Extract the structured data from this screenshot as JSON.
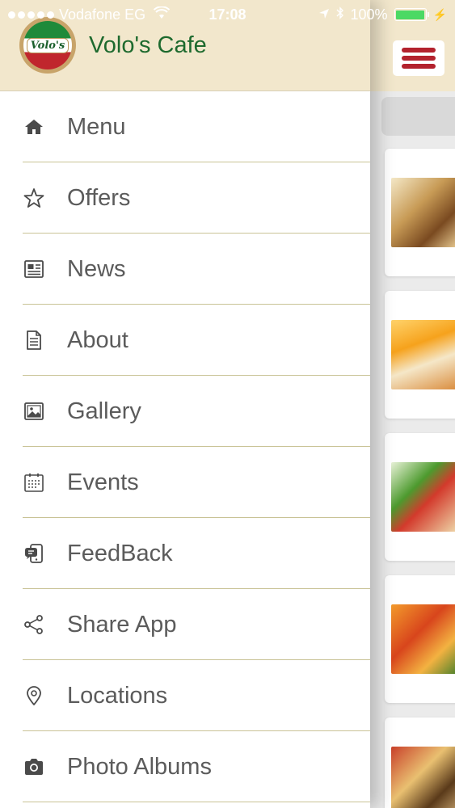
{
  "status_bar": {
    "carrier": "Vodafone EG",
    "time": "17:08",
    "battery": "100%",
    "battery_level": 1.0
  },
  "drawer": {
    "app_title": "Volo's Cafe",
    "logo_text": "Volo's",
    "items": [
      {
        "label": "Menu",
        "icon": "home-icon"
      },
      {
        "label": "Offers",
        "icon": "star-icon"
      },
      {
        "label": "News",
        "icon": "newspaper-icon"
      },
      {
        "label": "About",
        "icon": "document-icon"
      },
      {
        "label": "Gallery",
        "icon": "image-icon"
      },
      {
        "label": "Events",
        "icon": "calendar-icon"
      },
      {
        "label": "FeedBack",
        "icon": "feedback-icon"
      },
      {
        "label": "Share App",
        "icon": "share-icon"
      },
      {
        "label": "Locations",
        "icon": "location-pin-icon"
      },
      {
        "label": "Photo Albums",
        "icon": "camera-icon"
      }
    ]
  },
  "colors": {
    "header_bg": "#f2e7cc",
    "title_green": "#1e6a2e",
    "hamburger_red": "#b3222d",
    "divider": "#c9c396"
  }
}
